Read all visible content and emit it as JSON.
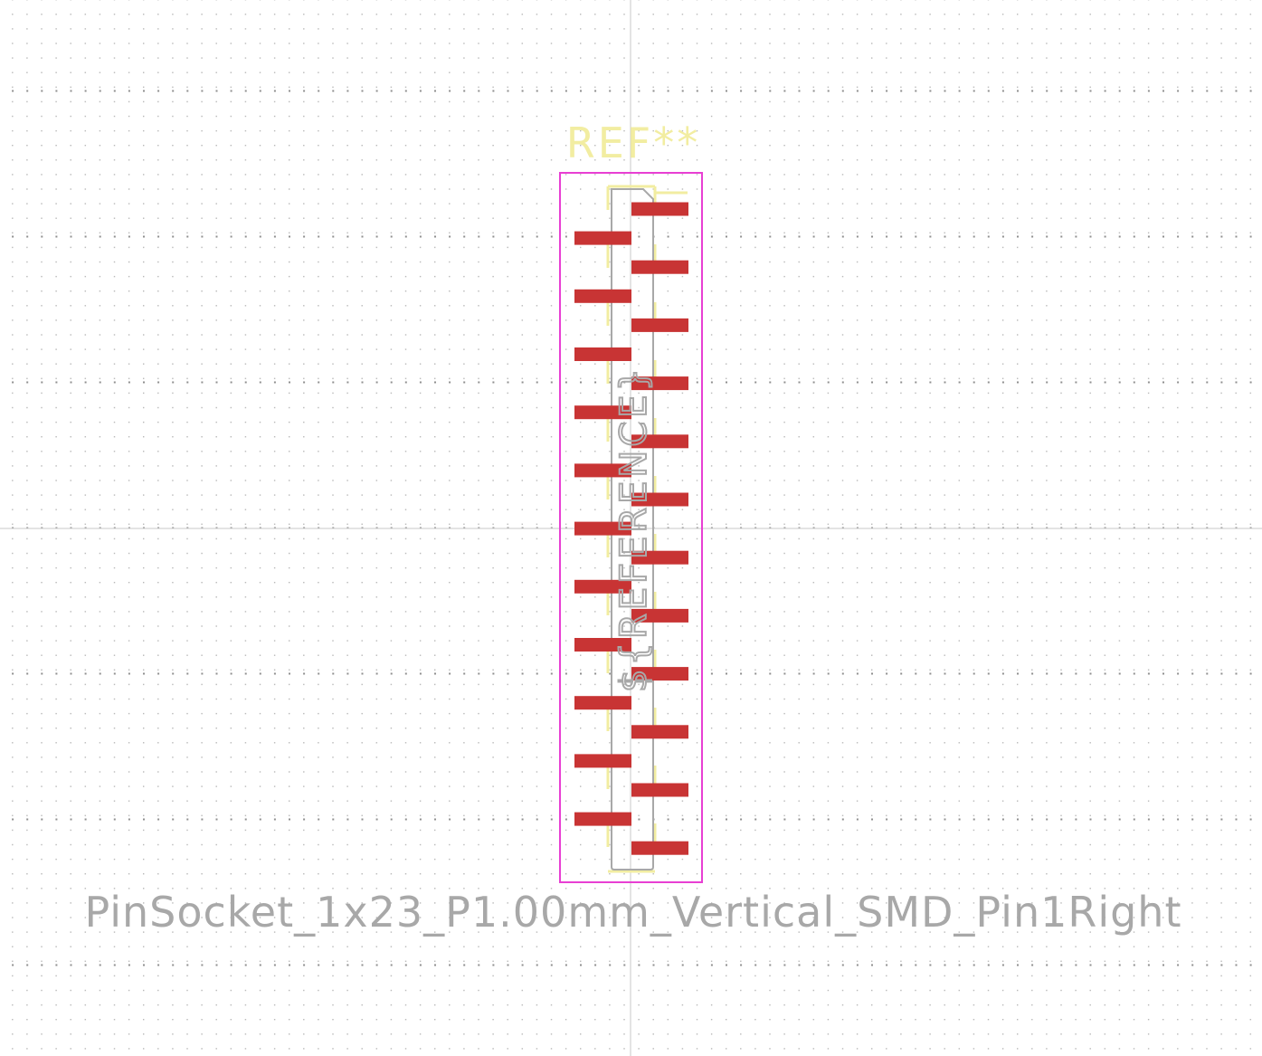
{
  "footprint": {
    "reference": "REF**",
    "fab_reference": "${REFERENCE}",
    "value": "PinSocket_1x23_P1.00mm_Vertical_SMD_Pin1Right",
    "pin_count": 23,
    "pitch": "1.00mm"
  },
  "colors": {
    "background": "#ffffff",
    "grid_dot": "#b7b7b7",
    "grid_dot_major": "#8f8f8f",
    "crosshair": "#c8c8c8",
    "pad": "#c83434",
    "silkscreen": "#f2eda1",
    "courtyard": "#e83fd3",
    "fab": "#a8a8a8"
  }
}
